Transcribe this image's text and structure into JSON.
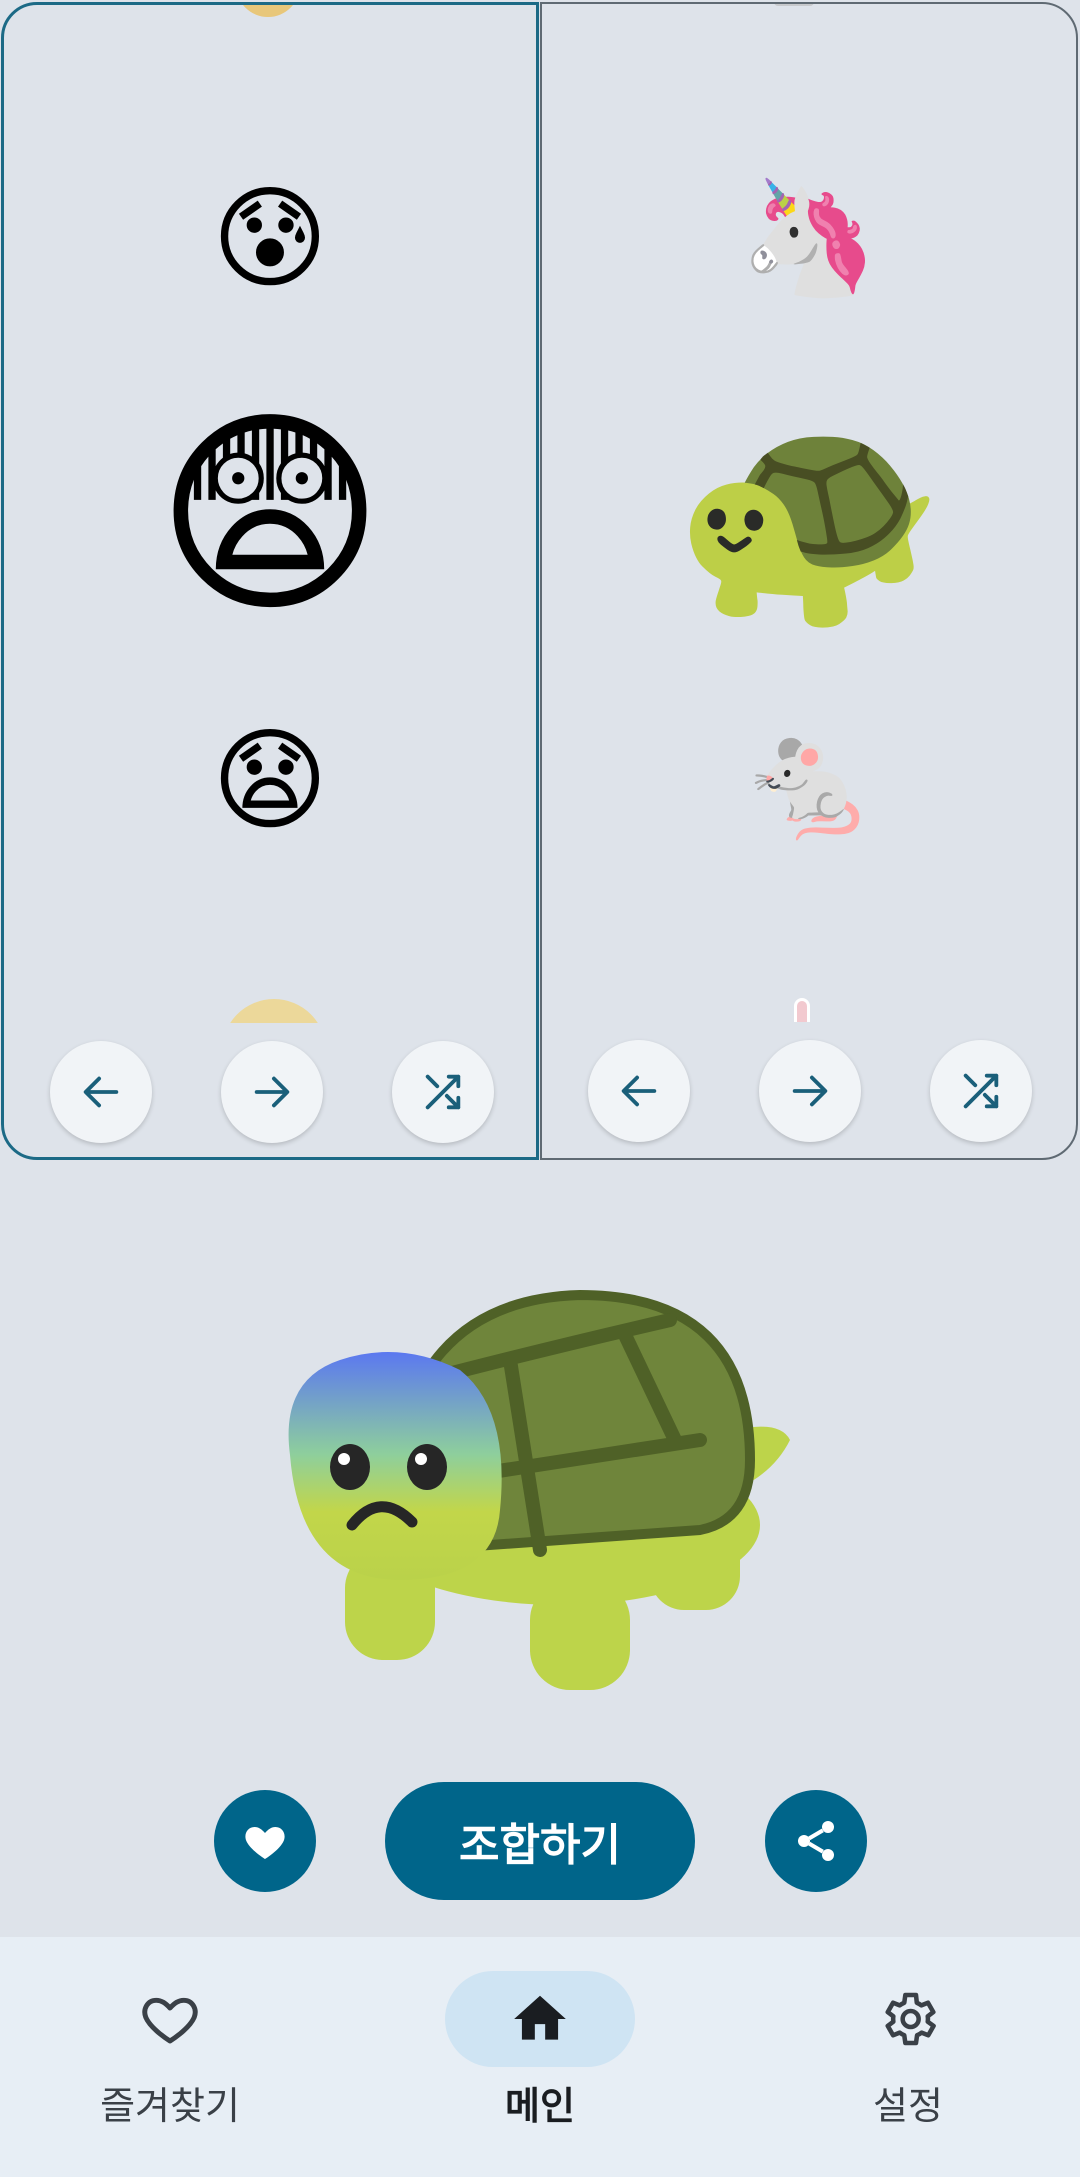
{
  "left_picker": {
    "emojis": [
      "😰",
      "😨",
      "😧"
    ],
    "selected": "😨",
    "buttons": [
      "previous",
      "next",
      "shuffle"
    ]
  },
  "right_picker": {
    "emojis": [
      "🦄",
      "🐢",
      "🐁"
    ],
    "selected": "🐢",
    "buttons": [
      "previous",
      "next",
      "shuffle"
    ]
  },
  "actions": {
    "favorite_icon": "heart-filled-icon",
    "combine_label": "조합하기",
    "share_icon": "share-icon"
  },
  "nav": {
    "items": [
      {
        "label": "즐겨찾기",
        "icon": "heart-outline-icon"
      },
      {
        "label": "메인",
        "icon": "home-icon",
        "active": true
      },
      {
        "label": "설정",
        "icon": "settings-gear-icon"
      }
    ]
  },
  "colors": {
    "background": "#dee3ea",
    "primary": "#00658a",
    "nav_background": "#e7eef5",
    "nav_active_pill": "#cfe4f3"
  }
}
